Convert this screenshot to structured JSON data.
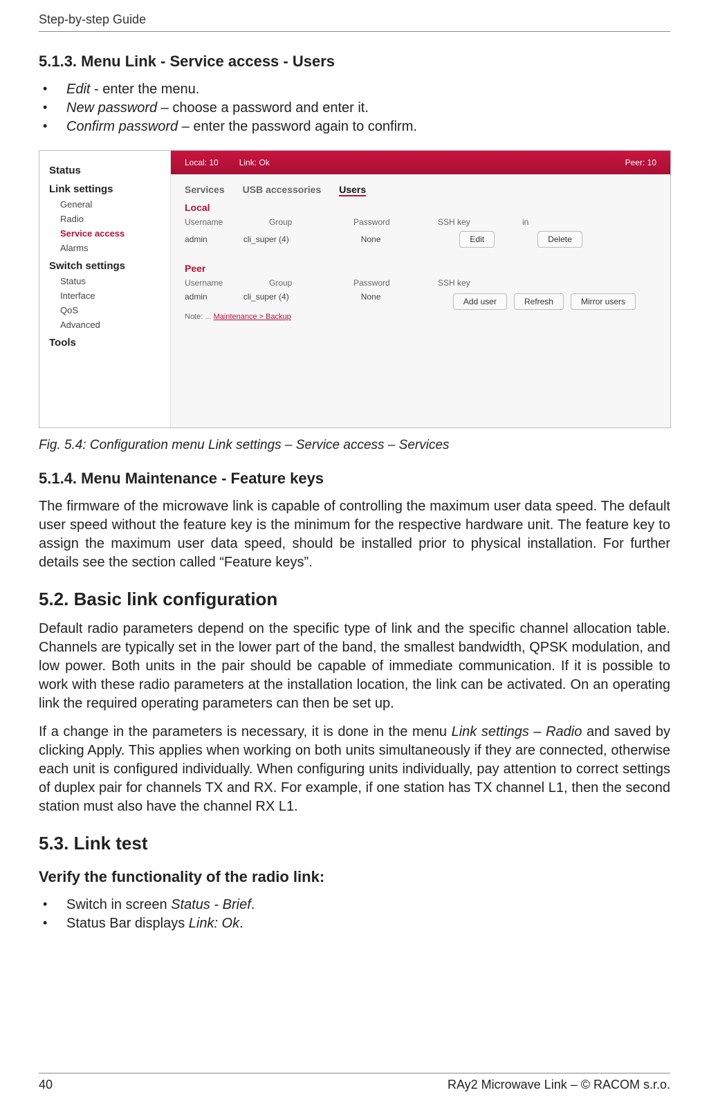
{
  "running_head": "Step-by-step Guide",
  "sec_513_title": "5.1.3. Menu Link - Service access - Users",
  "list_513": [
    {
      "term": "Edit",
      "sep": " - ",
      "desc": "enter the menu."
    },
    {
      "term": "New password",
      "sep": " – ",
      "desc": "choose a password and enter it."
    },
    {
      "term": "Confirm password",
      "sep": " – ",
      "desc": "enter the password again to confirm."
    }
  ],
  "shot": {
    "topbar": {
      "left": [
        "Local: 10",
        "Link: Ok"
      ],
      "right": [
        "Peer: 10"
      ]
    },
    "sidebar": {
      "groups": [
        {
          "head": "Status",
          "items": []
        },
        {
          "head": "Link settings",
          "items": [
            "General",
            "Radio",
            "Service access",
            "Alarms"
          ],
          "activeIndex": 2
        },
        {
          "head": "Switch settings",
          "items": [
            "Status",
            "Interface",
            "QoS",
            "Advanced"
          ]
        },
        {
          "head": "Tools",
          "items": []
        }
      ]
    },
    "tabs": [
      "Services",
      "USB accessories",
      "Users"
    ],
    "tab_active": 2,
    "local": {
      "title": "Local",
      "headers": [
        "Username",
        "Group",
        "Password",
        "SSH key",
        "in"
      ],
      "row": [
        "admin",
        "cli_super (4)",
        "",
        "None",
        ""
      ],
      "btns": [
        "Edit",
        "Delete"
      ]
    },
    "peer": {
      "title": "Peer",
      "headers": [
        "Username",
        "Group",
        "Password",
        "SSH key"
      ],
      "row": [
        "admin",
        "cli_super (4)",
        "",
        "None"
      ]
    },
    "note_pre": "Note: ... ",
    "note_link": "Maintenance > Backup",
    "buttons": [
      "Add user",
      "Refresh",
      "Mirror users"
    ]
  },
  "figcap": "Fig. 5.4: Configuration menu Link settings – Service access – Services",
  "sec_514_title": "5.1.4. Menu Maintenance - Feature keys",
  "p_514": "The firmware of the microwave link is capable of controlling the maximum user data speed. The default user speed without the feature key is the minimum for the respective hardware unit. The feature key to assign the maximum user data speed, should be installed prior to physical installation. For further details see the section called “Feature keys”.",
  "sec_52_title": "5.2. Basic link configuration",
  "p_52a": "Default radio parameters depend on the specific type of link and the specific channel allocation table. Channels are typically set in the lower part of the band, the smallest bandwidth, QPSK modulation, and low power. Both units in the pair should be capable of immediate communication. If it is possible to work with these radio parameters at the installation location, the link can be activated. On an operating link the required operating parameters can then be set up.",
  "p_52b_pre": "If a change in the parameters is necessary, it is done in the menu ",
  "p_52b_it": "Link settings – Radio",
  "p_52b_post": " and saved by clicking Apply. This applies when working on both units simultaneously if they are connected, otherwise each unit is configured individually. When configuring units individually, pay attention to correct settings of duplex pair for channels TX and RX. For example, if one station has TX channel L1, then the second station must also have the channel RX L1.",
  "sec_53_title": "5.3. Link test",
  "verify_title": "Verify the functionality of the radio link:",
  "list_53": [
    {
      "pre": "Switch in screen ",
      "it": "Status - Brief",
      "post": "."
    },
    {
      "pre": "Status Bar displays ",
      "it": "Link: Ok",
      "post": "."
    }
  ],
  "footer_left": "40",
  "footer_right": "RAy2 Microwave Link – © RACOM s.r.o."
}
